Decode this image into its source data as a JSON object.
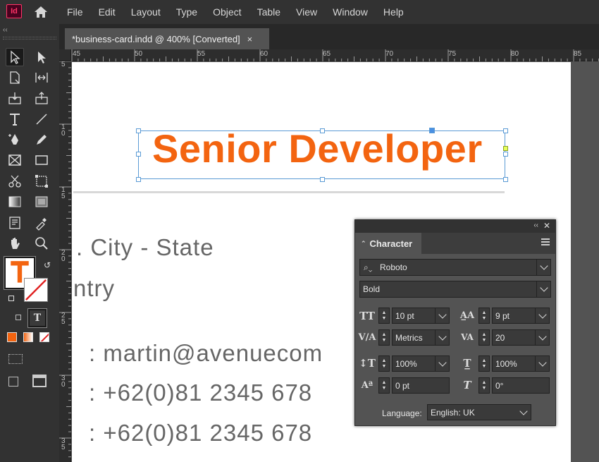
{
  "app": {
    "logo": "Id",
    "menu": [
      "File",
      "Edit",
      "Layout",
      "Type",
      "Object",
      "Table",
      "View",
      "Window",
      "Help"
    ]
  },
  "document": {
    "tab_title": "*business-card.indd @ 400% [Converted]",
    "close_glyph": "×"
  },
  "rulers": {
    "horizontal": [
      "45",
      "50",
      "55",
      "60",
      "65",
      "70",
      "75",
      "80",
      "85"
    ],
    "vertical": [
      "5",
      "1\n0",
      "1\n5",
      "2\n0",
      "2\n5",
      "3\n0",
      "3\n5"
    ]
  },
  "page": {
    "heading": "Senior Developer",
    "lines": [
      ". City - State",
      "ntry",
      ": martin@avenuecom",
      ": +62(0)81 2345 678",
      ": +62(0)81 2345 678"
    ]
  },
  "colors": {
    "accent": "#f36410",
    "selection": "#5b9bd5",
    "body_text": "#666666"
  },
  "character_panel": {
    "tab_label": "Character",
    "font_family": "Roboto",
    "font_style": "Bold",
    "font_size": "10 pt",
    "leading": "9 pt",
    "kerning": "Metrics",
    "tracking": "20",
    "vertical_scale": "100%",
    "horizontal_scale": "100%",
    "baseline_shift": "0 pt",
    "skew": "0°",
    "language_label": "Language:",
    "language_value": "English: UK"
  }
}
